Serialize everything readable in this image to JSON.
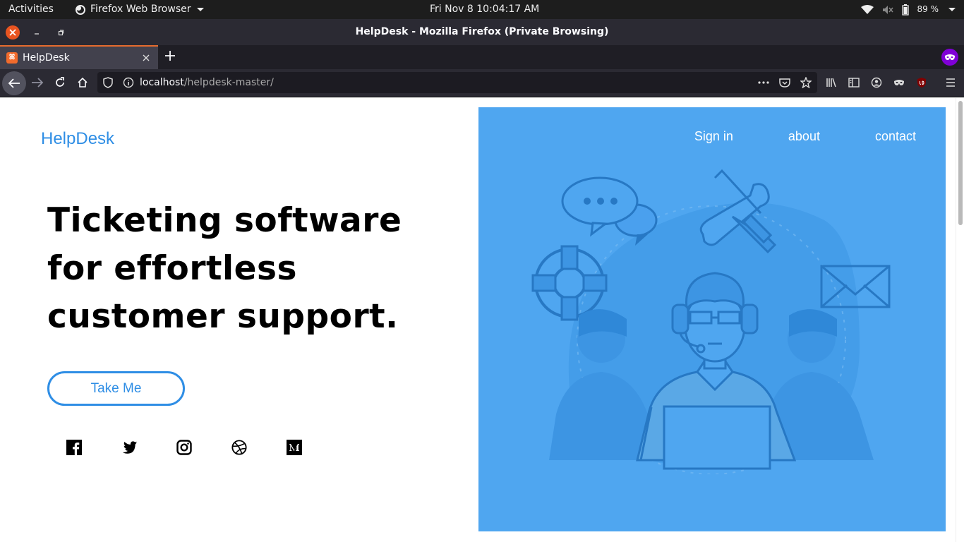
{
  "system_bar": {
    "activities": "Activities",
    "app_name": "Firefox Web Browser",
    "clock": "Fri Nov 8  10:04:17 AM",
    "battery": "89 %"
  },
  "window": {
    "title": "HelpDesk - Mozilla Firefox (Private Browsing)"
  },
  "tab": {
    "title": "HelpDesk",
    "favicon": "xampp-icon"
  },
  "navbar": {
    "url_host": "localhost",
    "url_path": "/helpdesk-master/"
  },
  "page": {
    "brand": "HelpDesk",
    "hero_title": "Ticketing software for effortless customer support.",
    "cta_label": "Take Me",
    "nav_links": [
      "Sign in",
      "about",
      "contact"
    ],
    "social_icons": [
      "facebook-icon",
      "twitter-icon",
      "instagram-icon",
      "dribbble-icon",
      "medium-icon"
    ],
    "accent_color": "#2f8ee5",
    "panel_color": "#4fa6f0"
  }
}
